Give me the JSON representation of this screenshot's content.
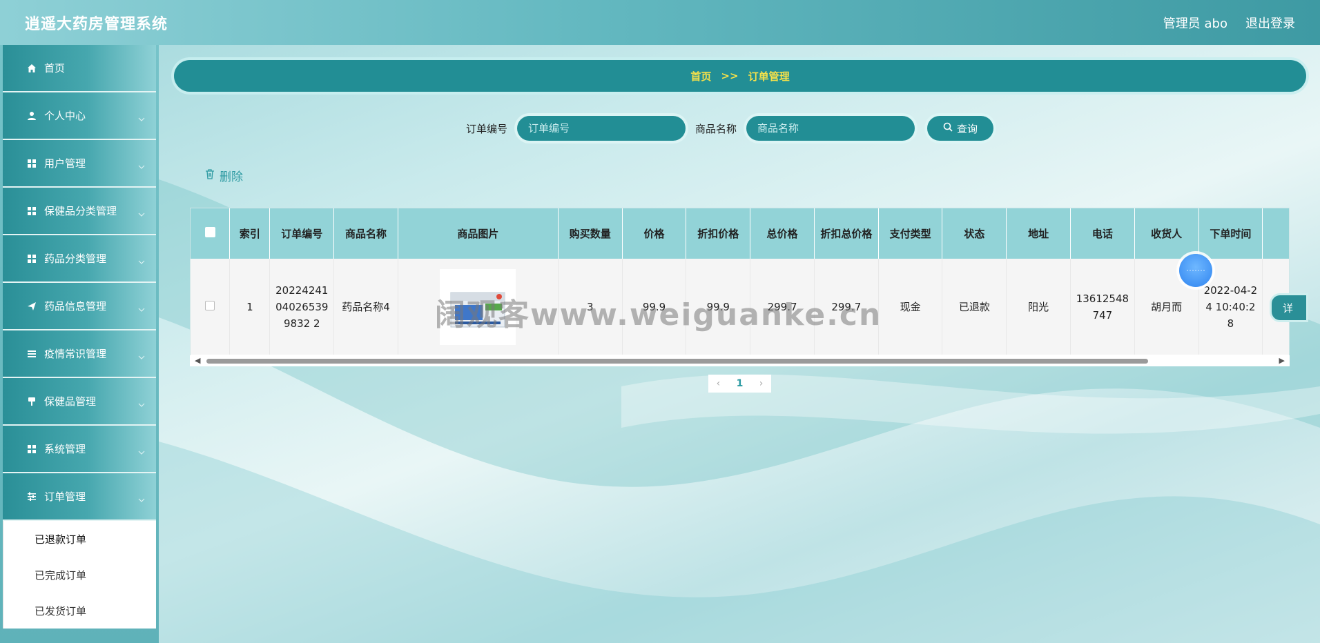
{
  "header": {
    "app_title": "逍遥大药房管理系统",
    "admin_label": "管理员 abo",
    "logout_label": "退出登录"
  },
  "sidebar": {
    "items": [
      {
        "label": "首页",
        "icon": "home-icon"
      },
      {
        "label": "个人中心",
        "icon": "user-icon"
      },
      {
        "label": "用户管理",
        "icon": "grid-icon"
      },
      {
        "label": "保健品分类管理",
        "icon": "grid-icon"
      },
      {
        "label": "药品分类管理",
        "icon": "grid-icon"
      },
      {
        "label": "药品信息管理",
        "icon": "send-icon"
      },
      {
        "label": "疫情常识管理",
        "icon": "list-icon"
      },
      {
        "label": "保健品管理",
        "icon": "brush-icon"
      },
      {
        "label": "系统管理",
        "icon": "grid-icon"
      },
      {
        "label": "订单管理",
        "icon": "sliders-icon"
      }
    ],
    "submenu": [
      "已退款订单",
      "已完成订单",
      "已发货订单"
    ]
  },
  "breadcrumb": {
    "home": "首页",
    "separator": ">>",
    "current": "订单管理"
  },
  "search": {
    "order_no_label": "订单编号",
    "order_no_placeholder": "订单编号",
    "product_label": "商品名称",
    "product_placeholder": "商品名称",
    "query_label": "查询"
  },
  "actions": {
    "delete_label": "删除",
    "detail_label": "详"
  },
  "table": {
    "columns": [
      "索引",
      "订单编号",
      "商品名称",
      "商品图片",
      "购买数量",
      "价格",
      "折扣价格",
      "总价格",
      "折扣总价格",
      "支付类型",
      "状态",
      "地址",
      "电话",
      "收货人",
      "下单时间"
    ],
    "rows": [
      {
        "index": "1",
        "order_no": "20224241040265399832 2",
        "product_name": "药品名称4",
        "quantity": "3",
        "price": "99.9",
        "discount_price": "99.9",
        "total_price": "299.7",
        "discount_total": "299.7",
        "pay_type": "现金",
        "status": "已退款",
        "address": "阳光",
        "phone": "13612548747",
        "receiver": "胡月而",
        "order_time": "2022-04-24 10:40:28"
      }
    ]
  },
  "pagination": {
    "current_page": "1"
  },
  "watermark": "阔观客www.weiguanke.cn",
  "colors": {
    "primary": "#228e95",
    "header_th": "#92d3d7",
    "breadcrumb_text": "#f5e14a",
    "accent_text": "#2d9aa2"
  }
}
